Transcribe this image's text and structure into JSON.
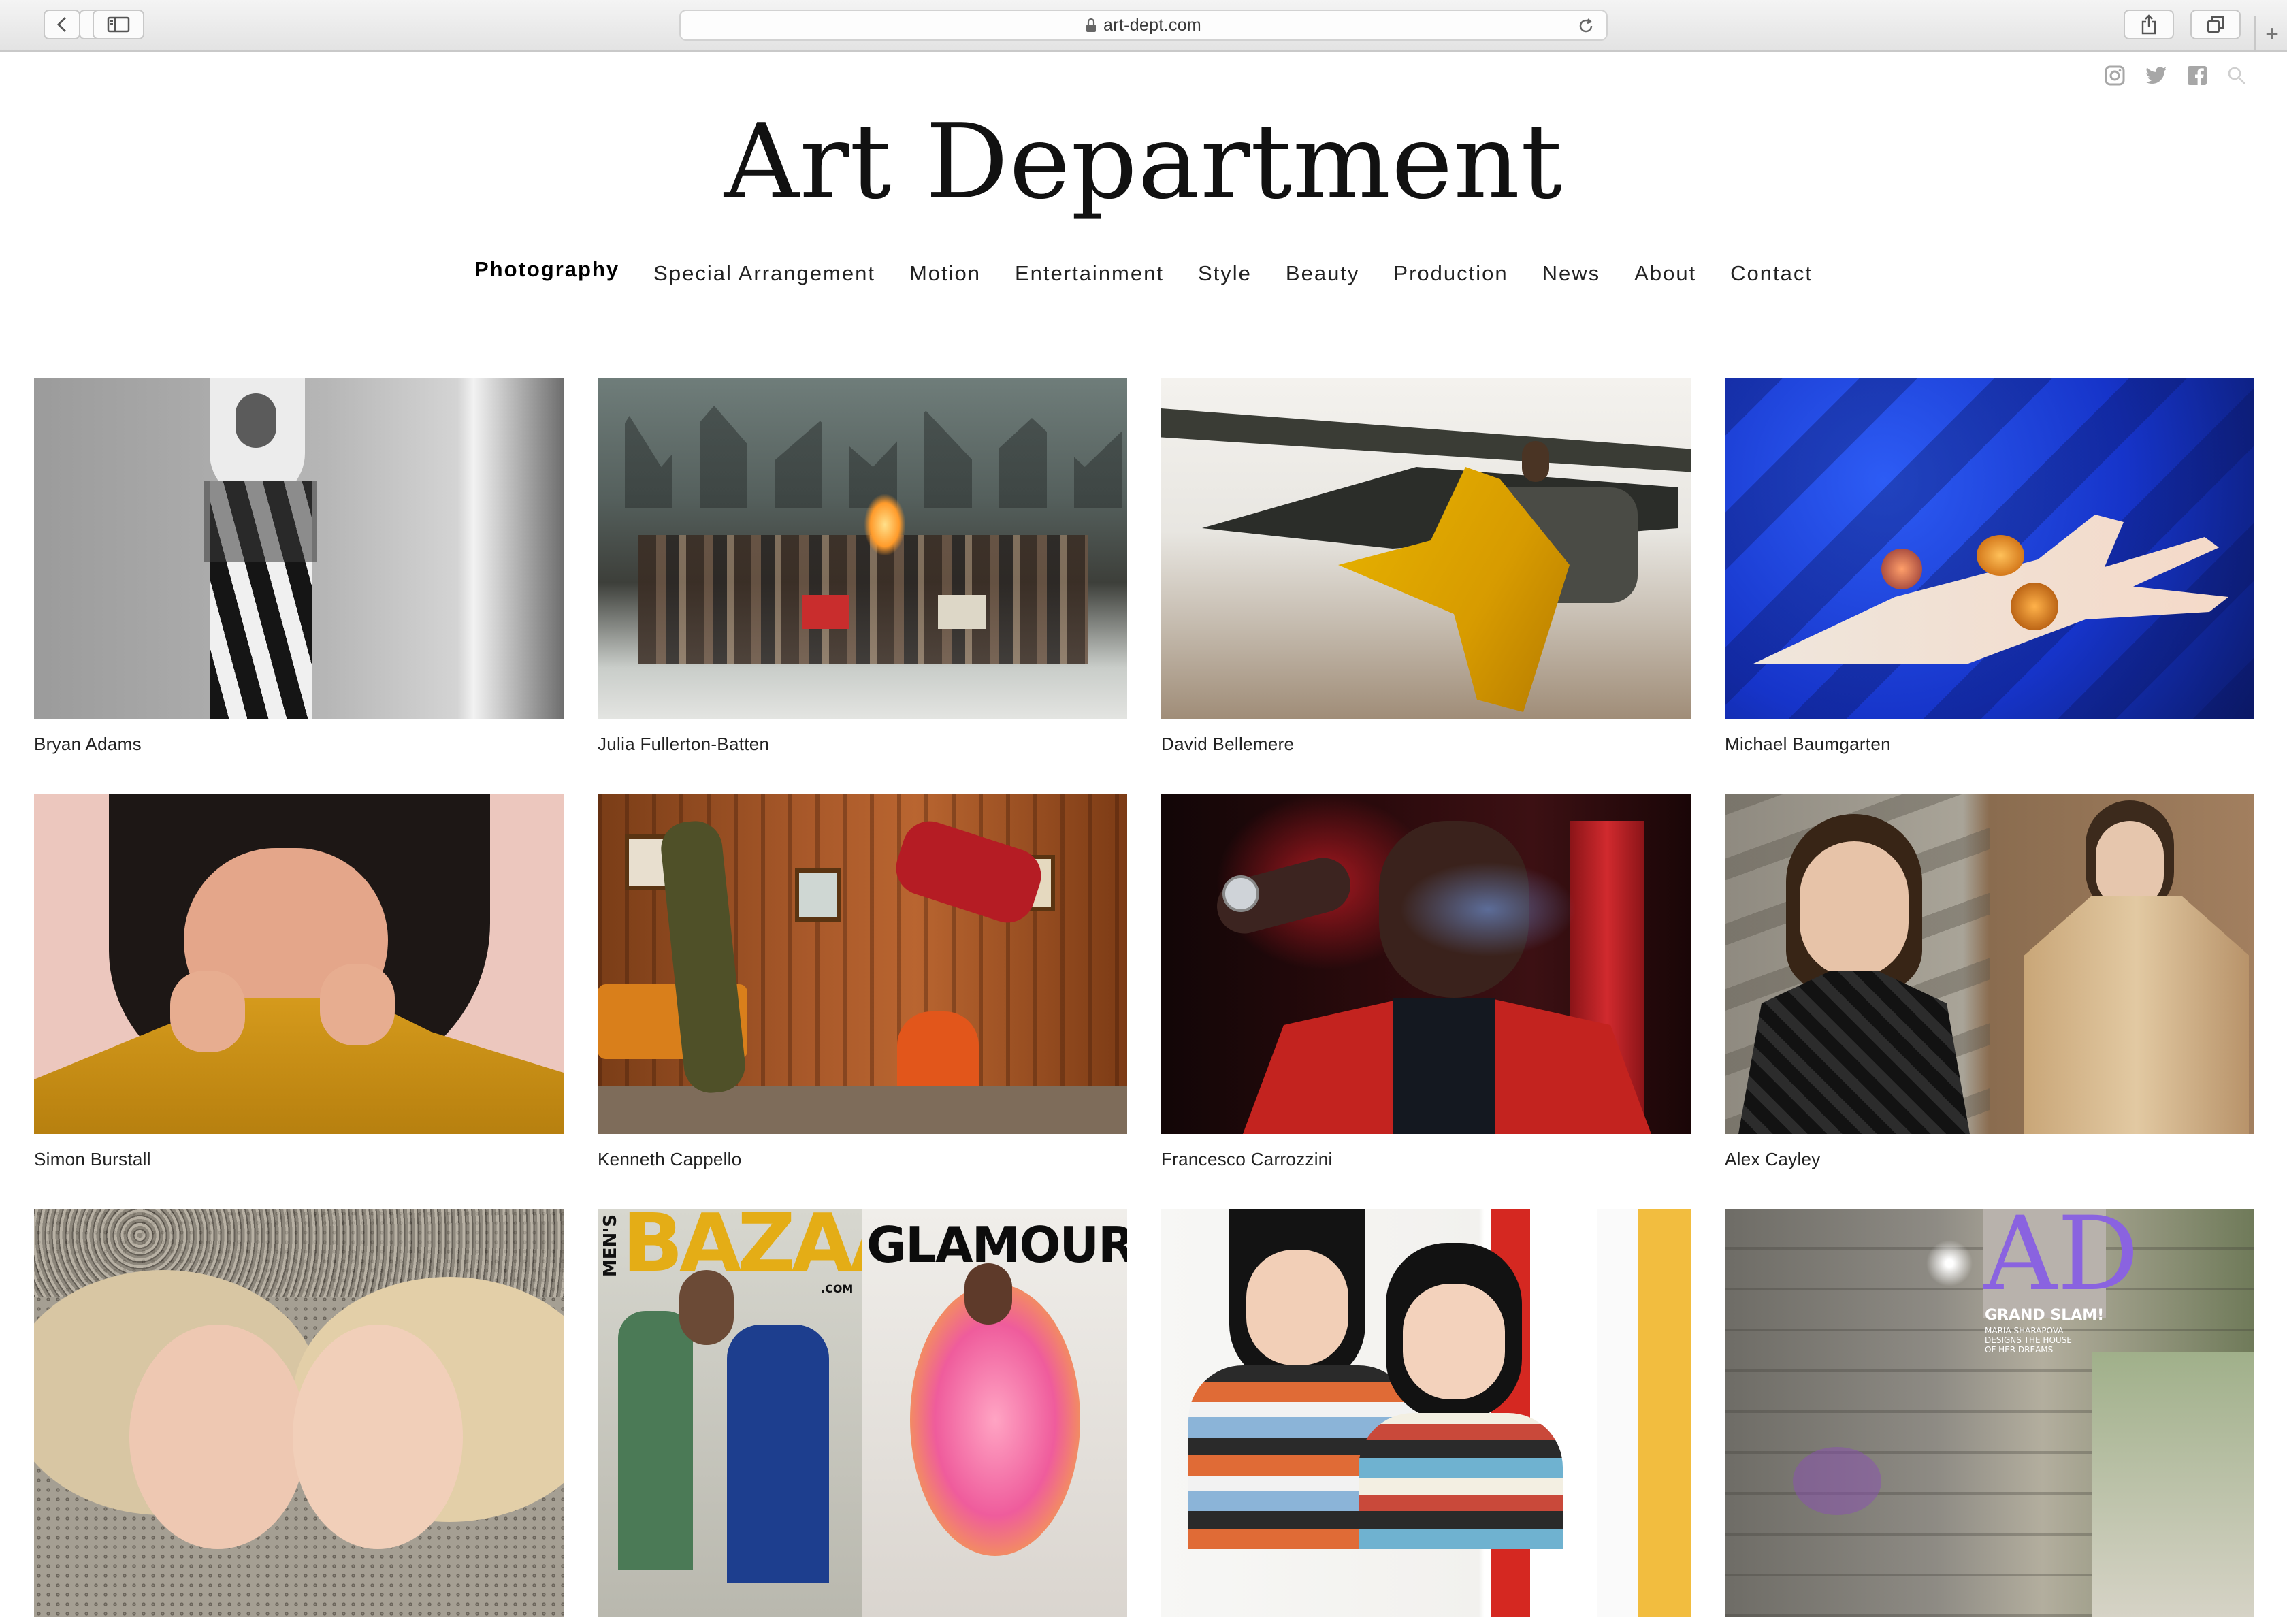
{
  "browser": {
    "url": "art-dept.com"
  },
  "site": {
    "title": "Art Department"
  },
  "nav": [
    {
      "label": "Photography",
      "active": true
    },
    {
      "label": "Special Arrangement"
    },
    {
      "label": "Motion"
    },
    {
      "label": "Entertainment"
    },
    {
      "label": "Style"
    },
    {
      "label": "Beauty"
    },
    {
      "label": "Production"
    },
    {
      "label": "News"
    },
    {
      "label": "About"
    },
    {
      "label": "Contact"
    }
  ],
  "social_icons": [
    "instagram-icon",
    "twitter-icon",
    "facebook-icon",
    "search-icon"
  ],
  "artists": [
    {
      "name": "Bryan Adams"
    },
    {
      "name": "Julia Fullerton-Batten"
    },
    {
      "name": "David Bellemere"
    },
    {
      "name": "Michael Baumgarten"
    },
    {
      "name": "Simon Burstall"
    },
    {
      "name": "Kenneth Cappello"
    },
    {
      "name": "Francesco Carrozzini"
    },
    {
      "name": "Alex Cayley"
    }
  ],
  "partial_row": {
    "bazaar_mens": "MEN'S",
    "bazaar_title": "BAZAAR",
    "bazaar_com": ".COM",
    "glamour_title": "GLAMOUR",
    "ad_title": "AD",
    "ad_head": "GRAND SLAM!",
    "ad_sub1": "MARIA SHARAPOVA",
    "ad_sub2": "DESIGNS THE HOUSE",
    "ad_sub3": "OF HER DREAMS"
  },
  "colors": {
    "text": "#111111",
    "background": "#ffffff"
  }
}
